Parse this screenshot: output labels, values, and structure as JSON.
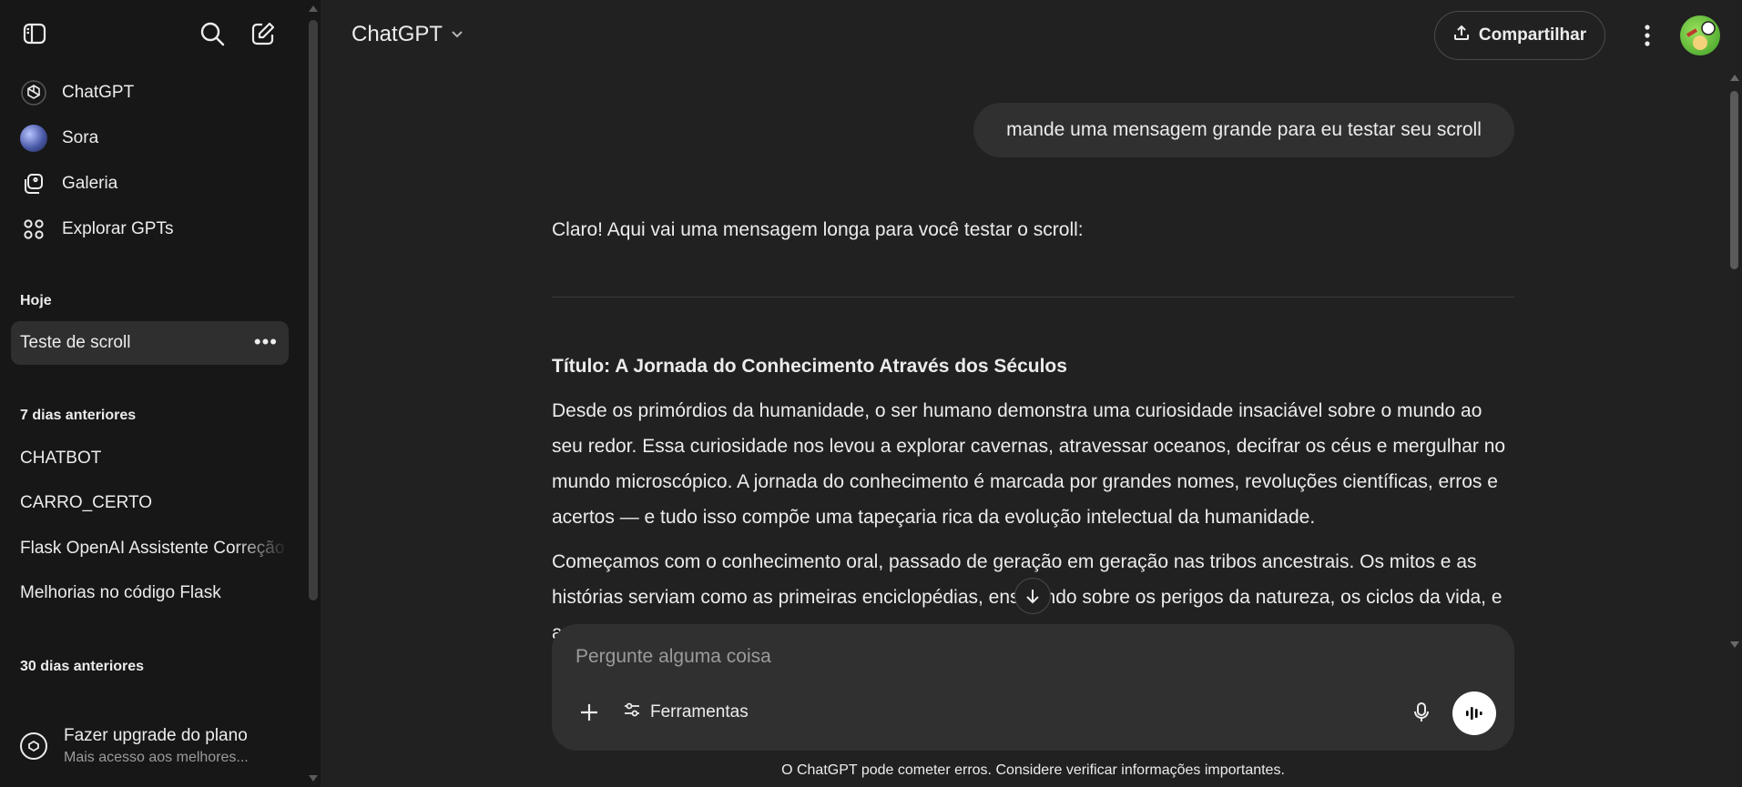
{
  "sidebar": {
    "nav": [
      {
        "label": "ChatGPT",
        "icon": "openai-logo-icon"
      },
      {
        "label": "Sora",
        "icon": "sora-icon"
      },
      {
        "label": "Galeria",
        "icon": "gallery-icon"
      },
      {
        "label": "Explorar GPTs",
        "icon": "grid-icon"
      }
    ],
    "sections": [
      {
        "label": "Hoje",
        "chats": [
          "Teste de scroll"
        ]
      },
      {
        "label": "7 dias anteriores",
        "chats": [
          "CHATBOT",
          "CARRO_CERTO",
          "Flask OpenAI Assistente Correção",
          "Melhorias no código Flask"
        ]
      },
      {
        "label": "30 dias anteriores",
        "chats": []
      }
    ],
    "active_chat_dots": "•••",
    "upgrade": {
      "title": "Fazer upgrade do plano",
      "subtitle": "Mais acesso aos melhores..."
    }
  },
  "header": {
    "model": "ChatGPT",
    "share_label": "Compartilhar"
  },
  "conversation": {
    "user_message": "mande uma mensagem grande para eu testar seu scroll",
    "assistant_intro": "Claro! Aqui vai uma mensagem longa para você testar o scroll:",
    "assistant_title": "Título: A Jornada do Conhecimento Através dos Séculos",
    "paragraphs": [
      "Desde os primórdios da humanidade, o ser humano demonstra uma curiosidade insaciável sobre o mundo ao seu redor. Essa curiosidade nos levou a explorar cavernas, atravessar oceanos, decifrar os céus e mergulhar no mundo microscópico. A jornada do conhecimento é marcada por grandes nomes, revoluções científicas, erros e acertos — e tudo isso compõe uma tapeçaria rica da evolução intelectual da humanidade.",
      "Começamos com o conhecimento oral, passado de geração em geração nas tribos ancestrais. Os mitos e as histórias serviam como as primeiras enciclopédias, ensinando sobre os perigos da natureza, os ciclos da vida, e as crenças que davam sentido ao mundo."
    ]
  },
  "composer": {
    "placeholder": "Pergunte alguma coisa",
    "tools_label": "Ferramentas"
  },
  "disclaimer": "O ChatGPT pode cometer erros. Considere verificar informações importantes.",
  "colors": {
    "background": "#212121",
    "sidebar": "#171717",
    "bubble": "#303030",
    "text": "#ececec",
    "muted": "#9b9b9b"
  }
}
